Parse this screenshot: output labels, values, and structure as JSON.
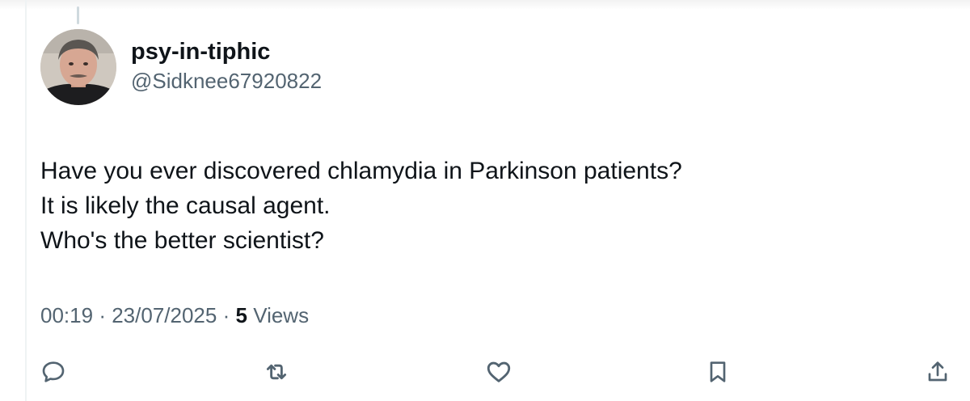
{
  "tweet": {
    "author": {
      "display_name": "psy-in-tiphic",
      "handle": "@Sidknee67920822"
    },
    "text_lines": [
      "Have you ever discovered chlamydia in Parkinson patients?",
      "It is likely the causal agent.",
      "Who's the better scientist?"
    ],
    "time": "00:19",
    "date": "23/07/2025",
    "separator": "·",
    "views_count": "5",
    "views_label": "Views"
  },
  "actions": {
    "reply": "reply-icon",
    "retweet": "retweet-icon",
    "like": "heart-icon",
    "bookmark": "bookmark-icon",
    "share": "share-icon"
  },
  "colors": {
    "text_primary": "#0f1419",
    "text_secondary": "#536471",
    "icon": "#536471",
    "thread_line": "#cfd9de"
  }
}
